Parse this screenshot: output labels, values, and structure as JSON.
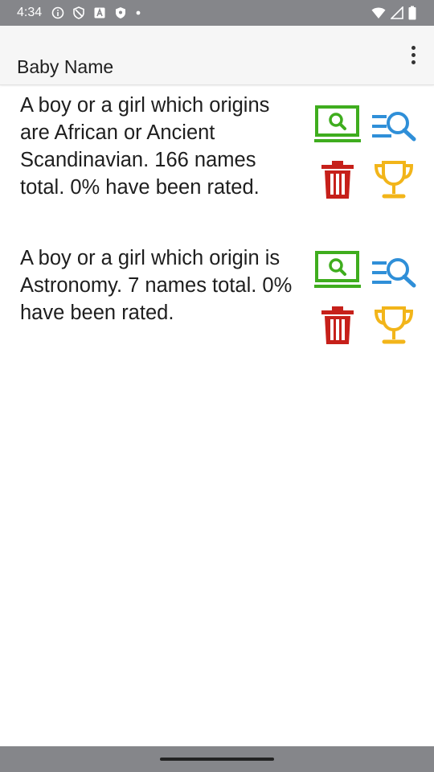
{
  "status_bar": {
    "time": "4:34",
    "left_icons": [
      "info-icon",
      "shield-icon",
      "font-icon",
      "shield-check-icon",
      "dot-icon"
    ],
    "right_icons": [
      "wifi-icon",
      "signal-icon",
      "battery-icon"
    ]
  },
  "app_bar": {
    "title": "Baby Name",
    "menu_icon": "more-vert-icon"
  },
  "lists": [
    {
      "description": "A boy or a girl which origins are African or Ancient Scandinavian. 166 names total. 0% have been rated.",
      "actions": [
        "view-names",
        "search-names",
        "delete",
        "rankings"
      ]
    },
    {
      "description": "A boy or a girl which origin is Astronomy. 7 names total. 0% have been rated.",
      "actions": [
        "view-names",
        "search-names",
        "delete",
        "rankings"
      ]
    }
  ],
  "colors": {
    "status_bar": "#85868a",
    "app_bar": "#f6f6f6",
    "view_green": "#3fad1e",
    "search_blue": "#2f8fd8",
    "delete_red": "#c6201a",
    "trophy_gold": "#f2b51a"
  }
}
